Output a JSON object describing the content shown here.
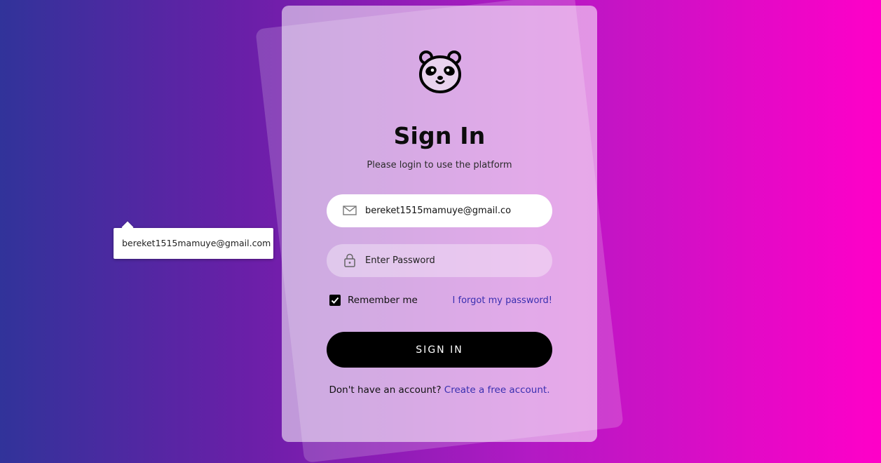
{
  "title": "Sign In",
  "subtitle": "Please login to use the platform",
  "email": {
    "value": "bereket1515mamuye@gmail.co",
    "icon": "mail-icon"
  },
  "autocomplete": {
    "suggestion": "bereket1515mamuye@gmail.com"
  },
  "password": {
    "placeholder": "Enter Password",
    "icon": "lock-icon"
  },
  "remember": {
    "label": "Remember me",
    "checked": true
  },
  "forgot_label": "I forgot my password!",
  "signin_label": "SIGN IN",
  "footer": {
    "text": "Don't have an account?",
    "link": "Create a free account."
  },
  "colors": {
    "link": "#3a2fb0",
    "button": "#000000",
    "gradient_start": "#31339a",
    "gradient_end": "#ff00c8"
  }
}
